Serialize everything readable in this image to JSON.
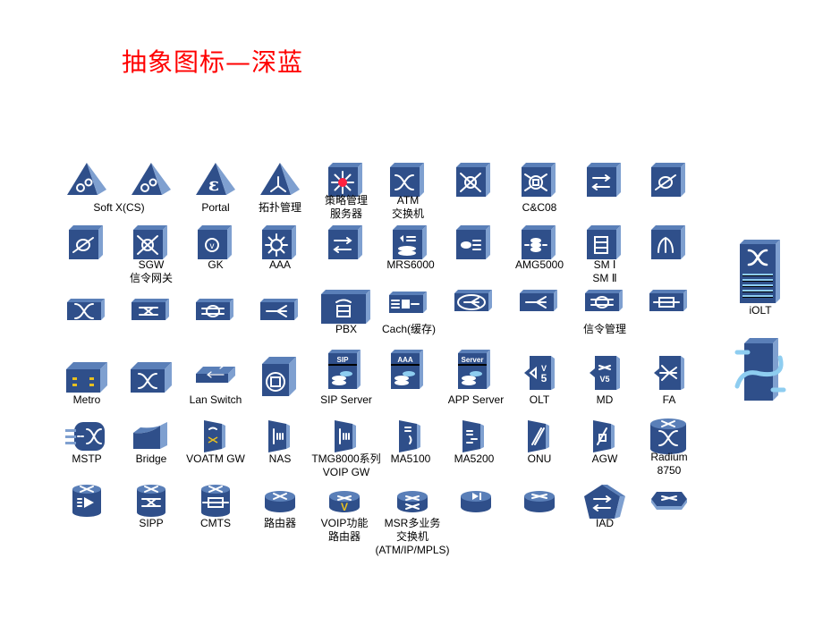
{
  "title": "抽象图标—深蓝",
  "colors": {
    "title": "#ff0000",
    "face": "#2f4f8a",
    "side": "#7fa0d0",
    "top": "#5a7fb8",
    "glyph": "#ffffff",
    "accent_red": "#ff2040",
    "accent_yellow": "#e8c020",
    "accent_light": "#8ecdf0"
  },
  "icons": [
    {
      "name": "soft-x-cs-triangle-1",
      "shape": "triangle",
      "glyph": "gears",
      "label": ""
    },
    {
      "name": "soft-x-cs-triangle-2",
      "shape": "triangle",
      "glyph": "gears",
      "label": ""
    },
    {
      "name": "portal-triangle",
      "shape": "triangle",
      "glyph": "epsilon",
      "label": "Portal"
    },
    {
      "name": "topology-mgmt-triangle",
      "shape": "triangle",
      "glyph": "tri-spoke",
      "label": "拓扑管理"
    },
    {
      "name": "policy-mgmt-server",
      "shape": "cube",
      "glyph": "starburst",
      "label": "策略管理\n服务器"
    },
    {
      "name": "atm-switch",
      "shape": "cube",
      "glyph": "cross-arrows",
      "label": "ATM\n交换机"
    },
    {
      "name": "switch-ring",
      "shape": "cube",
      "glyph": "ring-arrows",
      "label": ""
    },
    {
      "name": "c-and-c08",
      "shape": "cube",
      "glyph": "ring-box",
      "label": "C&C08"
    },
    {
      "name": "switch-arrows",
      "shape": "cube",
      "glyph": "parallel-arrows",
      "label": ""
    },
    {
      "name": "switch-loop",
      "shape": "cube",
      "glyph": "loop",
      "label": ""
    },
    {
      "name": "cube-loop",
      "shape": "cube",
      "glyph": "loop2",
      "label": ""
    },
    {
      "name": "sgw",
      "shape": "cube",
      "glyph": "ring-arrows",
      "label": "SGW\n信令网关"
    },
    {
      "name": "gk",
      "shape": "cube",
      "glyph": "v-ring",
      "label": "GK"
    },
    {
      "name": "aaa",
      "shape": "cube",
      "glyph": "gear-star",
      "label": "AAA"
    },
    {
      "name": "cube-exchange",
      "shape": "cube",
      "glyph": "parallel-arrows",
      "label": ""
    },
    {
      "name": "mrs6000",
      "shape": "cube",
      "glyph": "db-speaker",
      "label": "MRS6000"
    },
    {
      "name": "cube-ellipse",
      "shape": "cube",
      "glyph": "ellipse-arrows",
      "label": ""
    },
    {
      "name": "amg5000",
      "shape": "cube",
      "glyph": "db-arrows",
      "label": "AMG5000"
    },
    {
      "name": "sm",
      "shape": "cube",
      "glyph": "panel-arrows",
      "label": "SM Ⅰ\nSM Ⅱ"
    },
    {
      "name": "cube-up-arrows",
      "shape": "cube",
      "glyph": "up-arrows",
      "label": ""
    },
    {
      "name": "flat-switch-1",
      "shape": "flat",
      "glyph": "cross-arrows",
      "label": ""
    },
    {
      "name": "flat-switch-2",
      "shape": "flat",
      "glyph": "cross-lines",
      "label": ""
    },
    {
      "name": "flat-switch-3",
      "shape": "flat",
      "glyph": "ring-lines",
      "label": ""
    },
    {
      "name": "flat-switch-4",
      "shape": "flat",
      "glyph": "fan-out",
      "label": ""
    },
    {
      "name": "pbx",
      "shape": "box",
      "glyph": "phone",
      "label": "PBX"
    },
    {
      "name": "cache",
      "shape": "flat",
      "glyph": "db-in",
      "label": "Cach(缓存)"
    },
    {
      "name": "flat-cloud",
      "shape": "flat",
      "glyph": "cloud-fan",
      "label": ""
    },
    {
      "name": "flat-fan",
      "shape": "flat",
      "glyph": "fan-out",
      "label": ""
    },
    {
      "name": "signaling-mgmt",
      "shape": "flat",
      "glyph": "ring-lines",
      "label": "信令管理"
    },
    {
      "name": "flat-bidir",
      "shape": "flat",
      "glyph": "bidir",
      "label": ""
    },
    {
      "name": "metro",
      "shape": "chassis",
      "glyph": "metro",
      "label": "Metro"
    },
    {
      "name": "chassis-switch",
      "shape": "chassis",
      "glyph": "cross-arrows",
      "label": ""
    },
    {
      "name": "lan-switch",
      "shape": "thin",
      "glyph": "parallel-arrows",
      "label": "Lan Switch"
    },
    {
      "name": "server-cube",
      "shape": "bigcube",
      "glyph": "circle-box",
      "label": ""
    },
    {
      "name": "sip-server",
      "shape": "server",
      "glyph": "SIP",
      "label": "SIP Server"
    },
    {
      "name": "aaa-server",
      "shape": "server",
      "glyph": "AAA",
      "label": ""
    },
    {
      "name": "app-server",
      "shape": "server",
      "glyph": "Server",
      "label": "APP Server"
    },
    {
      "name": "olt",
      "shape": "v5",
      "glyph": "v5",
      "label": "OLT"
    },
    {
      "name": "md",
      "shape": "v5md",
      "glyph": "v5md",
      "label": "MD"
    },
    {
      "name": "fa",
      "shape": "fa",
      "glyph": "fa",
      "label": "FA"
    },
    {
      "name": "mstp",
      "shape": "mstp",
      "glyph": "mstp",
      "label": "MSTP"
    },
    {
      "name": "bridge",
      "shape": "bridge",
      "glyph": "none",
      "label": "Bridge"
    },
    {
      "name": "voatm-gw",
      "shape": "panel",
      "glyph": "phone-x",
      "label": "VOATM GW"
    },
    {
      "name": "nas",
      "shape": "panel",
      "glyph": "bars",
      "label": "NAS"
    },
    {
      "name": "tmg8000",
      "shape": "panel",
      "glyph": "bars",
      "label": "TMG8000系列\nVOIP GW"
    },
    {
      "name": "ma5100",
      "shape": "panel",
      "glyph": "brace",
      "label": "MA5100"
    },
    {
      "name": "ma5200",
      "shape": "panel",
      "glyph": "arrows-panel",
      "label": "MA5200"
    },
    {
      "name": "onu",
      "shape": "panel",
      "glyph": "slash",
      "label": "ONU"
    },
    {
      "name": "agw",
      "shape": "panel",
      "glyph": "agw",
      "label": "AGW"
    },
    {
      "name": "radium-8750",
      "shape": "cyl-tall",
      "glyph": "cross-arrows",
      "label": "Radium\n8750"
    },
    {
      "name": "router-play",
      "shape": "cylinder",
      "glyph": "play-list",
      "label": ""
    },
    {
      "name": "sipp",
      "shape": "cylinder",
      "glyph": "cross-lines",
      "label": "SIPP"
    },
    {
      "name": "cmts",
      "shape": "cylinder",
      "glyph": "bidir",
      "label": "CMTS"
    },
    {
      "name": "router",
      "shape": "router",
      "glyph": "router",
      "label": "路由器"
    },
    {
      "name": "voip-router",
      "shape": "router",
      "glyph": "router-v",
      "label": "VOIP功能\n路由器"
    },
    {
      "name": "msr-switch",
      "shape": "router",
      "glyph": "router-x",
      "label": "MSR多业务\n交换机\n(ATM/IP/MPLS)"
    },
    {
      "name": "router-playback",
      "shape": "router",
      "glyph": "play",
      "label": ""
    },
    {
      "name": "router-flat",
      "shape": "router",
      "glyph": "router-arrows",
      "label": ""
    },
    {
      "name": "iad",
      "shape": "pentagon",
      "glyph": "parallel-arrows",
      "label": "IAD"
    },
    {
      "name": "hex-switch",
      "shape": "hex",
      "glyph": "router",
      "label": ""
    },
    {
      "name": "iolt",
      "shape": "rack",
      "glyph": "rack",
      "label": "iOLT"
    },
    {
      "name": "loop-tower",
      "shape": "tower",
      "glyph": "tower",
      "label": ""
    }
  ],
  "labels": {
    "soft_x_cs": "Soft X(CS)"
  }
}
